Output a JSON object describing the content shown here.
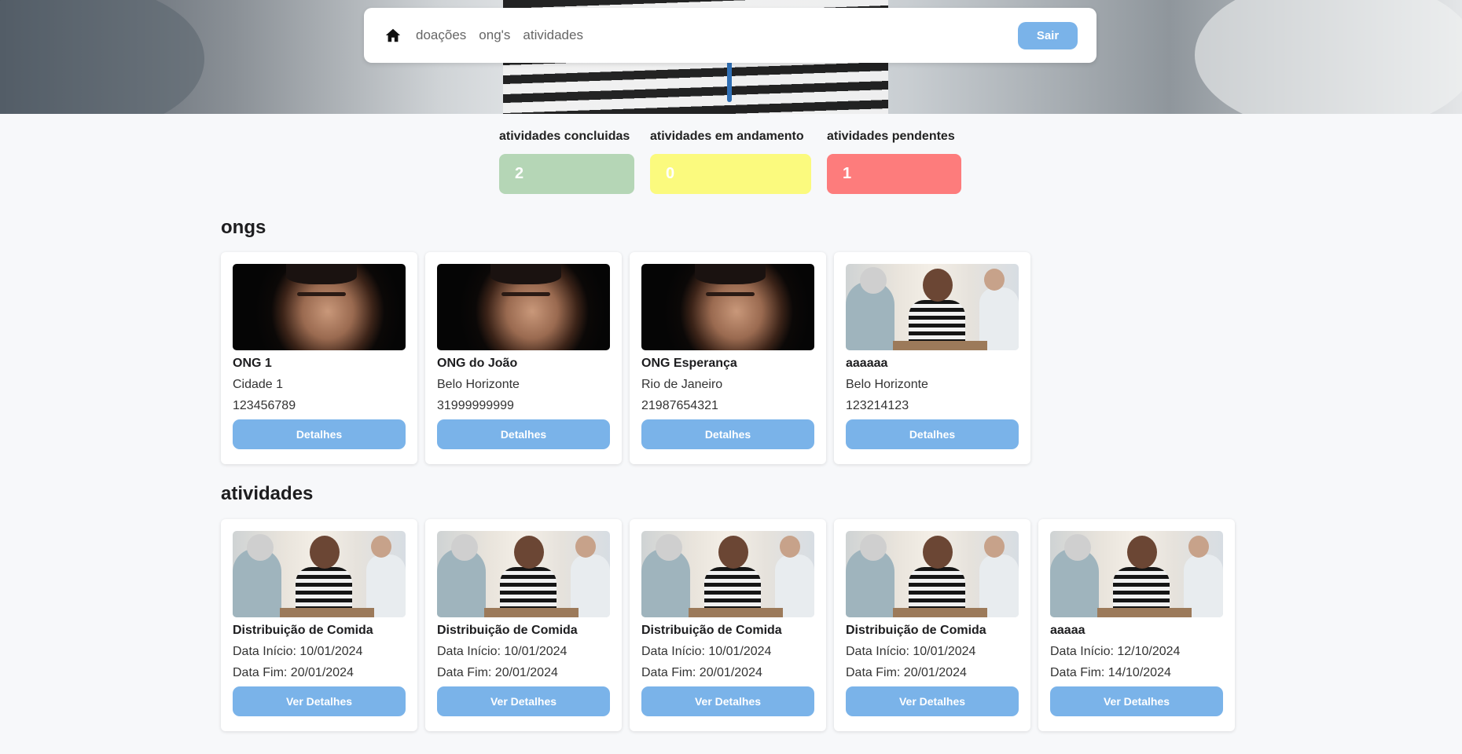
{
  "nav": {
    "home_icon": "home-icon",
    "links": [
      "doações",
      "ong's",
      "atividades"
    ],
    "logout_label": "Sair"
  },
  "stats": [
    {
      "label": "atividades concluidas",
      "value": "2",
      "color": "#b5d6b6"
    },
    {
      "label": "atividades em andamento",
      "value": "0",
      "color": "#fbfa7e"
    },
    {
      "label": "atividades pendentes",
      "value": "1",
      "color": "#fd7c7c"
    }
  ],
  "ongs": {
    "title": "ongs",
    "items": [
      {
        "name": "ONG 1",
        "city": "Cidade 1",
        "phone": "123456789",
        "image": "face-portrait",
        "button": "Detalhes"
      },
      {
        "name": "ONG do João",
        "city": "Belo Horizonte",
        "phone": "31999999999",
        "image": "face-portrait",
        "button": "Detalhes"
      },
      {
        "name": "ONG Esperança",
        "city": "Rio de Janeiro",
        "phone": "21987654321",
        "image": "face-portrait",
        "button": "Detalhes"
      },
      {
        "name": "aaaaaa",
        "city": "Belo Horizonte",
        "phone": "123214123",
        "image": "volunteers-group",
        "button": "Detalhes"
      }
    ]
  },
  "atividades": {
    "title": "atividades",
    "items": [
      {
        "name": "Distribuição de Comida",
        "start": "Data Início: 10/01/2024",
        "end": "Data Fim: 20/01/2024",
        "button": "Ver Detalhes"
      },
      {
        "name": "Distribuição de Comida",
        "start": "Data Início: 10/01/2024",
        "end": "Data Fim: 20/01/2024",
        "button": "Ver Detalhes"
      },
      {
        "name": "Distribuição de Comida",
        "start": "Data Início: 10/01/2024",
        "end": "Data Fim: 20/01/2024",
        "button": "Ver Detalhes"
      },
      {
        "name": "Distribuição de Comida",
        "start": "Data Início: 10/01/2024",
        "end": "Data Fim: 20/01/2024",
        "button": "Ver Detalhes"
      },
      {
        "name": "aaaaa",
        "start": "Data Início: 12/10/2024",
        "end": "Data Fim: 14/10/2024",
        "button": "Ver Detalhes"
      }
    ]
  },
  "colors": {
    "accent": "#7ab3e9",
    "background": "#f7f8fa"
  }
}
